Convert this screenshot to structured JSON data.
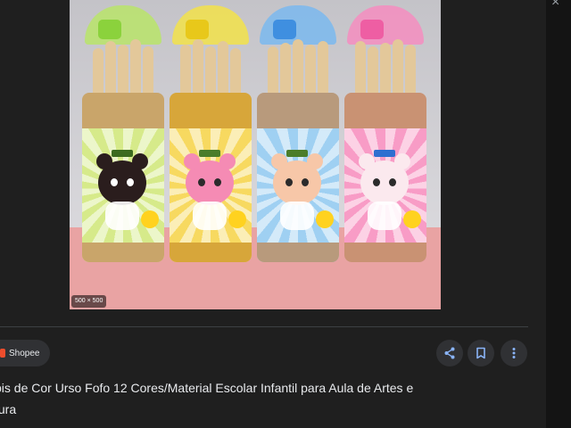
{
  "image": {
    "size_label": "500 × 500"
  },
  "source": {
    "name": "Shopee"
  },
  "actions": {
    "share_icon": "share-icon",
    "save_icon": "bookmark-icon",
    "more_icon": "more-vert-icon"
  },
  "product": {
    "title": "pis de Cor Urso Fofo 12 Cores/Material Escolar Infantil para Aula de Artes e\ntura"
  },
  "colors": {
    "background": "#1f1f1f",
    "chip": "#303134",
    "text": "#e8eaed",
    "shopee": "#ee4d2d",
    "accent_icon": "#8ab4f8"
  }
}
